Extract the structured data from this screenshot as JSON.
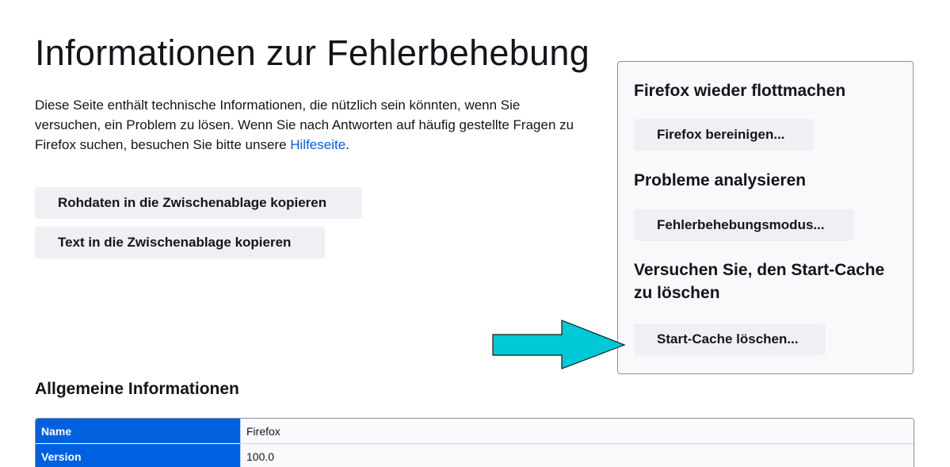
{
  "page": {
    "title": "Informationen zur Fehlerbehebung",
    "intro_text": "Diese Seite enthält technische Informationen, die nützlich sein könnten, wenn Sie versuchen, ein Problem zu lösen. Wenn Sie nach Antworten auf häufig gestellte Fragen zu Firefox suchen, besuchen Sie bitte unsere ",
    "intro_link": "Hilfeseite",
    "intro_end": "."
  },
  "actions": {
    "copy_raw_label": "Rohdaten in die Zwischenablage kopieren",
    "copy_text_label": "Text in die Zwischenablage kopieren"
  },
  "panel": {
    "refresh_heading": "Firefox wieder flottmachen",
    "refresh_button": "Firefox bereinigen...",
    "troubleshoot_heading": "Probleme analysieren",
    "troubleshoot_button": "Fehlerbehebungsmodus...",
    "startcache_heading": "Versuchen Sie, den Start-Cache zu löschen",
    "startcache_button": "Start-Cache löschen..."
  },
  "general": {
    "heading": "Allgemeine Informationen",
    "rows": [
      {
        "label": "Name",
        "value": "Firefox"
      },
      {
        "label": "Version",
        "value": "100.0"
      }
    ]
  },
  "colors": {
    "link": "#0061e0",
    "table_header": "#0061e0",
    "arrow_fill": "#00c8d6",
    "button_bg": "#f0f0f4"
  },
  "icons": {
    "annotation": "arrow-right-icon"
  }
}
